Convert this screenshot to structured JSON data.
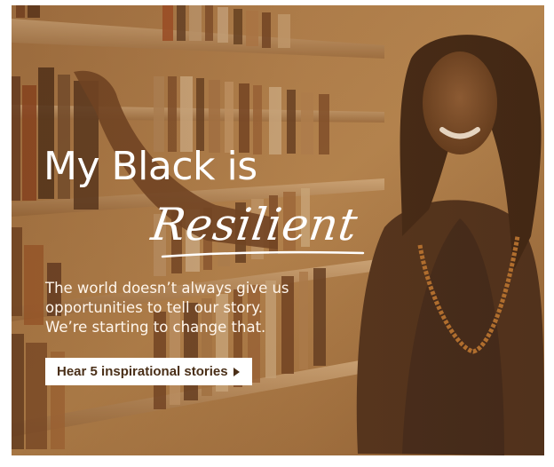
{
  "banner": {
    "headline": "My Black is",
    "script_word": "Resilient",
    "subtext_lines": [
      "The world doesn’t always give us",
      "opportunities to tell our story.",
      "We’re starting to change that."
    ],
    "cta_label": "Hear 5 inspirational stories",
    "cta_icon": "caret-right-icon",
    "photo_description_icon": "library-photo"
  },
  "colors": {
    "tint": "#8a5a2c",
    "text": "#ffffff",
    "cta_bg": "#ffffff",
    "cta_text": "#4a2f18"
  }
}
